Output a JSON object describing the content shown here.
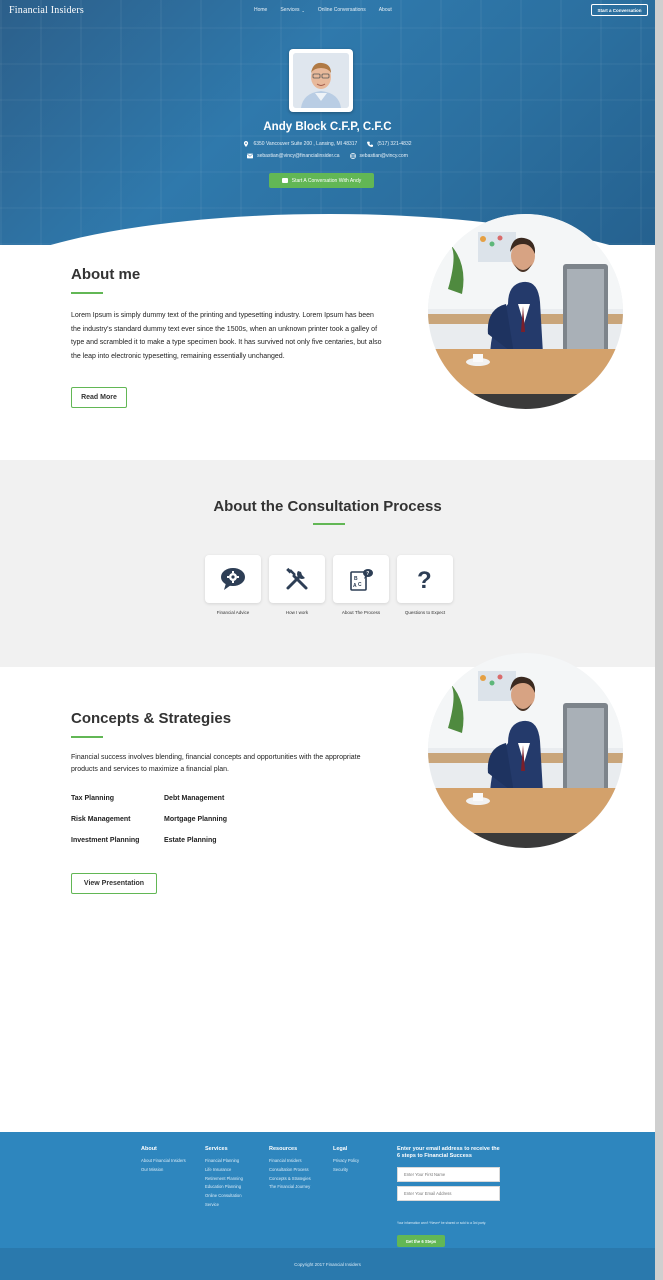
{
  "header": {
    "logo": "Financial Insiders",
    "nav": [
      {
        "label": "Home"
      },
      {
        "label": "Services",
        "has_dropdown": true
      },
      {
        "label": "Online Conversations"
      },
      {
        "label": "About"
      }
    ],
    "cta_label": "Start a Conversation"
  },
  "profile": {
    "name": "Andy Block C.F.P, C.F.C",
    "address": "6350 Vancouver Suite 200 , Lansing, MI 48317",
    "phone": "(517) 321-4832",
    "email": "sebastian@vincy@financialinsider.ca",
    "website": "sebastian@vincy.com",
    "cta_label": "Start A Conversation With Andy"
  },
  "about": {
    "title": "About me",
    "text": "Lorem Ipsum is simply dummy text of the printing and typesetting industry. Lorem Ipsum has been the industry's  standard dummy text ever since the 1500s, when an unknown printer took a galley of type and scrambled it to make a type specimen book. It has survived not only five centaries, but also the leap into electronic typesetting,  remaining essentially unchanged.",
    "button_label": "Read More"
  },
  "consultation": {
    "title": "About the Consultation Process",
    "items": [
      {
        "label": "Financial Advice",
        "icon": "advice-bubble-icon"
      },
      {
        "label": "How I work",
        "icon": "tools-icon"
      },
      {
        "label": "About The Process",
        "icon": "process-icon"
      },
      {
        "label": "Questions to Expect",
        "icon": "question-icon"
      }
    ]
  },
  "concepts": {
    "title": "Concepts & Strategies",
    "text": "Financial success involves blending, financial concepts and opportunities with the appropriate products and services to maximize a financial plan.",
    "left_items": [
      "Tax Planning",
      "Risk Management",
      "Investment Planning"
    ],
    "right_items": [
      "Debt Management",
      "Mortgage Planning",
      "Estate Planning"
    ],
    "button_label": "View Presentation"
  },
  "footer": {
    "columns": [
      {
        "heading": "About",
        "links": [
          "About Financial Insiders",
          "Our Mission"
        ]
      },
      {
        "heading": "Services",
        "links": [
          "Financial Planning",
          "Life Insurance",
          "Retirement Planning",
          "Education Planning",
          "Online Consultation",
          "Service"
        ]
      },
      {
        "heading": "Resources",
        "links": [
          "Financial Insiders",
          "Consultation Process",
          "Concepts & Strategies",
          "The Financial Journey"
        ]
      },
      {
        "heading": "Legal",
        "links": [
          "Privacy Policy",
          "Security"
        ]
      }
    ],
    "newsletter": {
      "title": "Enter your email address to receive the 6 steps to Financial Success",
      "first_name_placeholder": "Enter Your First Name",
      "email_placeholder": "Enter Your Email Address",
      "note": "Your information won't *Never* be shared or sold to a 3rd party.",
      "button_label": "Get the 6 Steps"
    },
    "copyright": "Copyright 2017 Financial Insiders"
  },
  "colors": {
    "brand_blue": "#2e86be",
    "accent_green": "#62b755",
    "icon_navy": "#2d3e55"
  }
}
